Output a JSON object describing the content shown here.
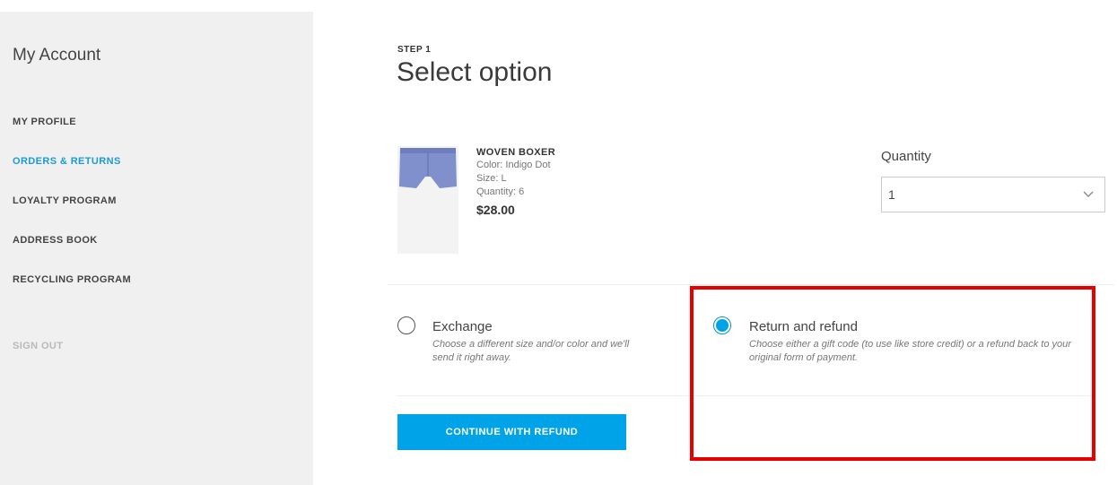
{
  "sidebar": {
    "title": "My Account",
    "items": [
      {
        "label": "MY PROFILE"
      },
      {
        "label": "ORDERS & RETURNS"
      },
      {
        "label": "LOYALTY PROGRAM"
      },
      {
        "label": "ADDRESS BOOK"
      },
      {
        "label": "RECYCLING PROGRAM"
      }
    ],
    "active_item": "ORDERS & RETURNS",
    "sign_out": "SIGN OUT"
  },
  "main": {
    "step": "STEP 1",
    "title": "Select option",
    "product": {
      "name": "WOVEN BOXER",
      "color": "Color: Indigo Dot",
      "size": "Size: L",
      "quantity": "Quantity: 6",
      "price": "$28.00"
    },
    "quantity_select": {
      "label": "Quantity",
      "value": "1"
    },
    "options": [
      {
        "title": "Exchange",
        "description_line1": "Choose a different size and/or color and we'll",
        "description_line2": "send it right away.",
        "selected": false
      },
      {
        "title": "Return and refund",
        "description_line1": "Choose either a gift code (to use like store credit) or a refund back to your",
        "description_line2": "original form of payment.",
        "selected": true
      }
    ],
    "continue_button": "CONTINUE WITH REFUND"
  },
  "colors": {
    "accent": "#00a3e8",
    "active_nav": "#1a9bd7",
    "highlight": "#e60000",
    "product_fabric": "#7f90cc"
  },
  "icons": {
    "quantity_dropdown": "chevron-down-icon"
  }
}
